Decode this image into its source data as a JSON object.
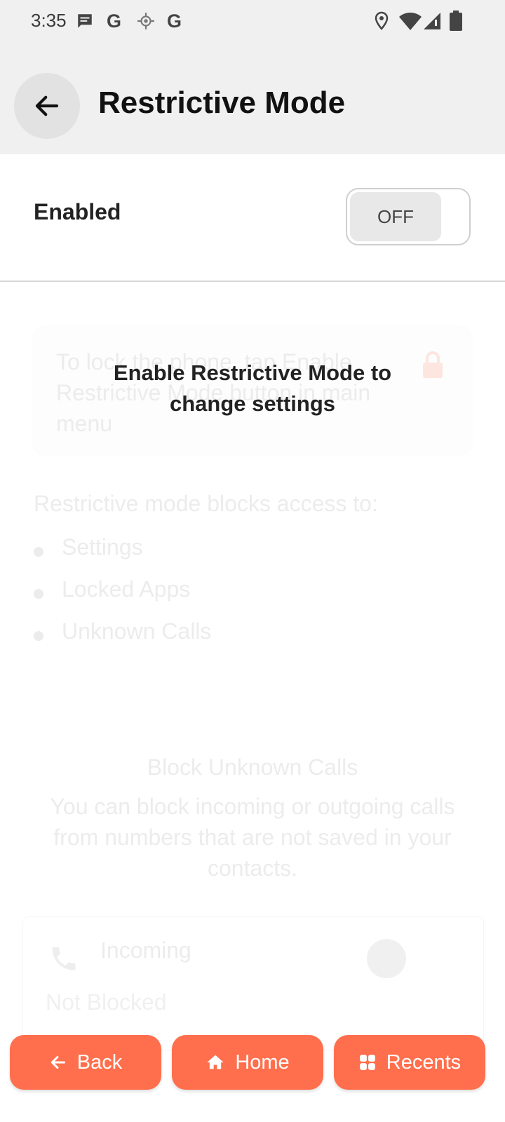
{
  "status_bar": {
    "time": "3:35",
    "left_icons": [
      "message-icon",
      "google-icon",
      "location-target-icon",
      "google-icon"
    ],
    "right_icons": [
      "location-pin-icon",
      "wifi-icon",
      "signal-icon",
      "battery-icon"
    ],
    "g_letter": "G"
  },
  "header": {
    "title": "Restrictive Mode",
    "back_icon": "arrow-left-icon"
  },
  "enabled_row": {
    "label": "Enabled",
    "toggle_state": "OFF"
  },
  "overlay_message": "Enable Restrictive Mode to change settings",
  "notice_card": {
    "text": "To lock the phone, tap Enable Restrictive Mode button in main menu",
    "icon": "lock-icon"
  },
  "blocks_section": {
    "heading": "Restrictive mode blocks access to:",
    "items": [
      "Settings",
      "Locked Apps",
      "Unknown Calls"
    ]
  },
  "block_unknown": {
    "title": "Block Unknown Calls",
    "description": "You can block incoming or outgoing calls from numbers that are not saved in your contacts."
  },
  "incoming_card": {
    "label": "Incoming",
    "status": "Not Blocked",
    "icon": "phone-icon"
  },
  "bottom_nav": {
    "back_label": "Back",
    "home_label": "Home",
    "recents_label": "Recents"
  },
  "colors": {
    "accent": "#ff6f4d",
    "header_bg": "#f0f0f0"
  }
}
